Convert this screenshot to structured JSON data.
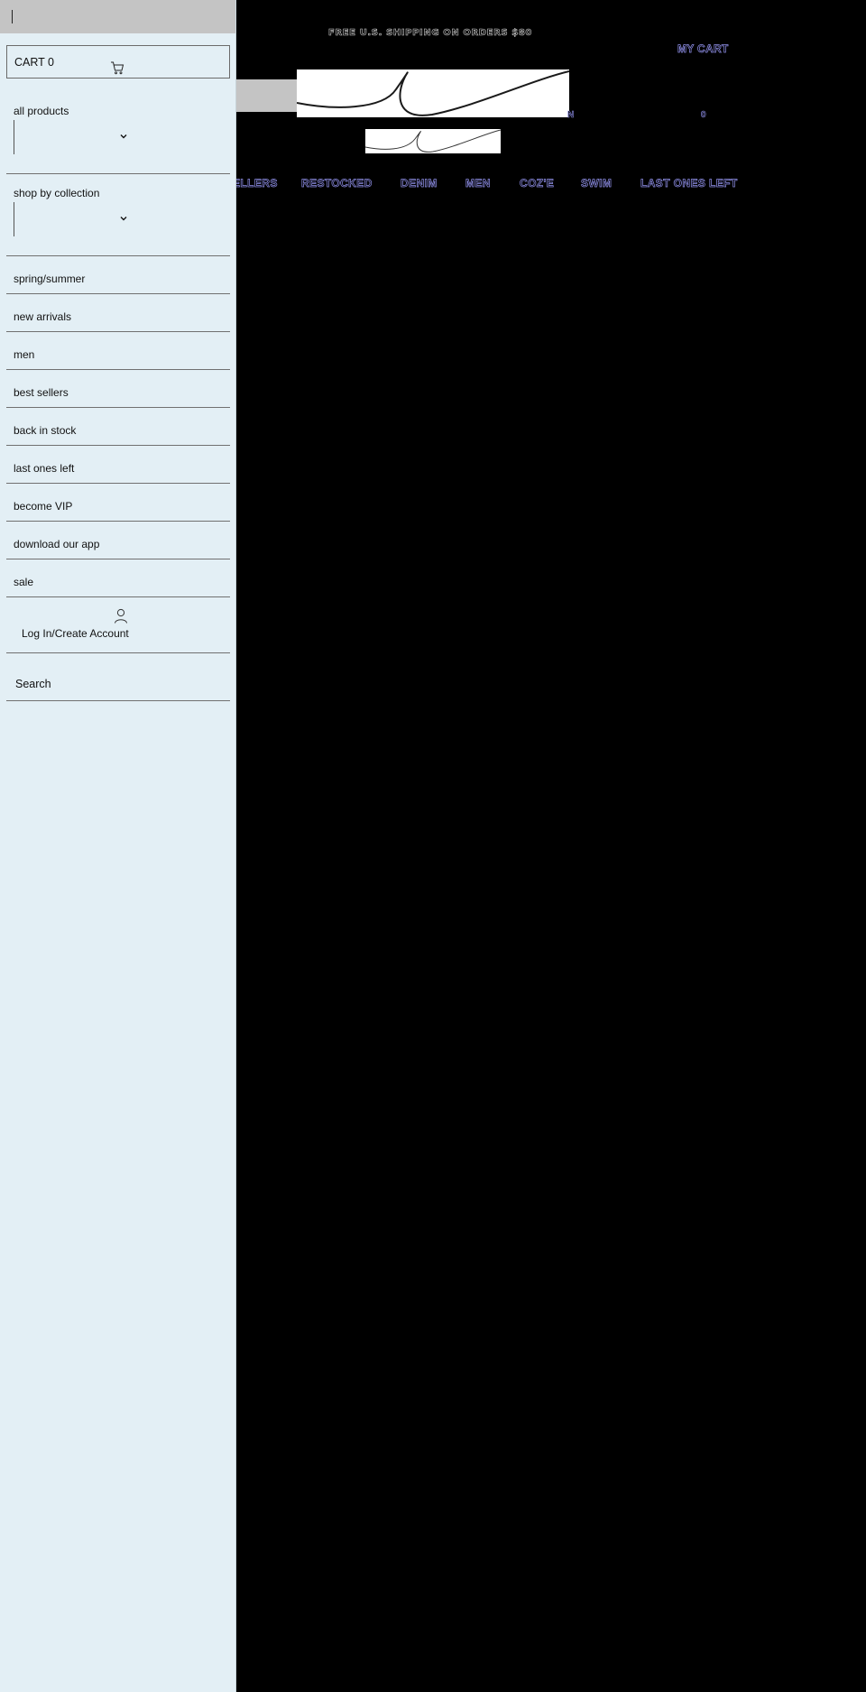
{
  "banner": {
    "shipping": "FREE U.S. SHIPPING ON ORDERS $80"
  },
  "header": {
    "my_cart": "MY CART",
    "link_a": "N",
    "link_b": "0"
  },
  "nav": [
    {
      "label": "ELLERS"
    },
    {
      "label": "RESTOCKED"
    },
    {
      "label": "DENIM"
    },
    {
      "label": "MEN"
    },
    {
      "label": "COZ'E"
    },
    {
      "label": "SWIM"
    },
    {
      "label": "LAST ONES LEFT"
    }
  ],
  "drawer": {
    "cart": {
      "label": "CART 0"
    },
    "sections": [
      {
        "title": "all products"
      },
      {
        "title": "shop by collection"
      }
    ],
    "menu": [
      {
        "label": "spring/summer"
      },
      {
        "label": "new arrivals"
      },
      {
        "label": "men"
      },
      {
        "label": "best sellers"
      },
      {
        "label": "back in stock"
      },
      {
        "label": "last ones left"
      },
      {
        "label": "become VIP"
      },
      {
        "label": "download our app"
      },
      {
        "label": "sale"
      }
    ],
    "account": {
      "label": "Log In/Create Account"
    },
    "search": {
      "label": "Search"
    }
  },
  "icons": {
    "cart": "cart-icon",
    "chevron": "chevron-down-icon",
    "user": "user-icon"
  },
  "colors": {
    "drawer_bg": "#e3eff5",
    "nav_outline": "#8f8fe8",
    "page_bg": "#000000"
  }
}
